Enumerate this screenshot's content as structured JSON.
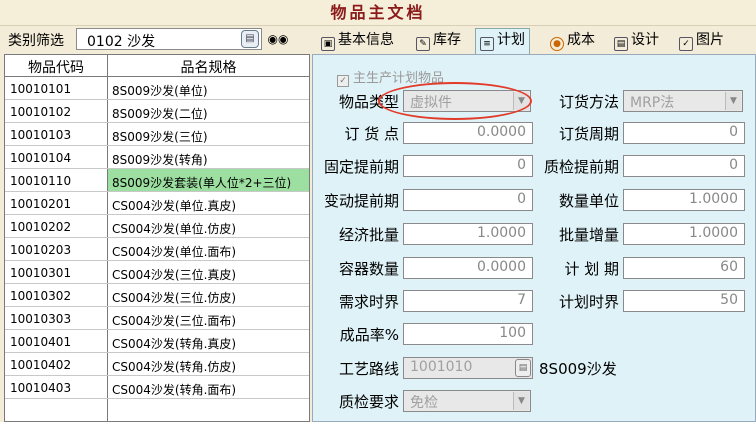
{
  "window": {
    "title": "物品主文档"
  },
  "filter": {
    "label": "类别筛选",
    "value": "0102 沙发"
  },
  "list": {
    "headers": [
      "物品代码",
      "品名规格"
    ],
    "rows": [
      [
        "10010101",
        "8S009沙发(单位)"
      ],
      [
        "10010102",
        "8S009沙发(二位)"
      ],
      [
        "10010103",
        "8S009沙发(三位)"
      ],
      [
        "10010104",
        "8S009沙发(转角)"
      ],
      [
        "10010110",
        "8S009沙发套装(单人位*2+三位)"
      ],
      [
        "10010201",
        "CS004沙发(单位.真皮)"
      ],
      [
        "10010202",
        "CS004沙发(单位.仿皮)"
      ],
      [
        "10010203",
        "CS004沙发(单位.面布)"
      ],
      [
        "10010301",
        "CS004沙发(三位.真皮)"
      ],
      [
        "10010302",
        "CS004沙发(三位.仿皮)"
      ],
      [
        "10010303",
        "CS004沙发(三位.面布)"
      ],
      [
        "10010401",
        "CS004沙发(转角.真皮)"
      ],
      [
        "10010402",
        "CS004沙发(转角.仿皮)"
      ],
      [
        "10010403",
        "CS004沙发(转角.面布)"
      ]
    ],
    "selected_index": 4
  },
  "tabs": [
    {
      "label": "基本信息",
      "icon": "info-icon"
    },
    {
      "label": "库存",
      "icon": "inventory-icon"
    },
    {
      "label": "计划",
      "icon": "plan-icon",
      "active": true
    },
    {
      "label": "成本",
      "icon": "cost-icon"
    },
    {
      "label": "设计",
      "icon": "design-icon"
    },
    {
      "label": "图片",
      "icon": "picture-icon"
    }
  ],
  "plan": {
    "main_plan_checkbox": {
      "label": "主生产计划物品",
      "checked": true
    },
    "item_type": {
      "label": "物品类型",
      "value": "虚拟件"
    },
    "order_method": {
      "label": "订货方法",
      "value": "MRP法"
    },
    "order_point": {
      "label": "订 货 点",
      "value": "0.0000"
    },
    "order_cycle": {
      "label": "订货周期",
      "value": "0"
    },
    "fixed_lead": {
      "label": "固定提前期",
      "value": "0"
    },
    "qc_lead": {
      "label": "质检提前期",
      "value": "0"
    },
    "var_lead": {
      "label": "变动提前期",
      "value": "0"
    },
    "qty_unit": {
      "label": "数量单位",
      "value": "1.0000"
    },
    "eco_batch": {
      "label": "经济批量",
      "value": "1.0000"
    },
    "batch_inc": {
      "label": "批量增量",
      "value": "1.0000"
    },
    "container_qty": {
      "label": "容器数量",
      "value": "0.0000"
    },
    "plan_period": {
      "label": "计 划 期",
      "value": "60"
    },
    "demand_fence": {
      "label": "需求时界",
      "value": "7"
    },
    "plan_fence": {
      "label": "计划时界",
      "value": "50"
    },
    "yield_rate": {
      "label": "成品率%",
      "value": "100"
    },
    "route": {
      "label": "工艺路线",
      "value": "1001010",
      "desc": "8S009沙发"
    },
    "qc_req": {
      "label": "质检要求",
      "value": "免检"
    }
  },
  "colors": {
    "title": "#8b1a1a",
    "panel": "#dff2f7",
    "selected_row": "#9cdfa0",
    "annotation": "#e23b2a"
  }
}
